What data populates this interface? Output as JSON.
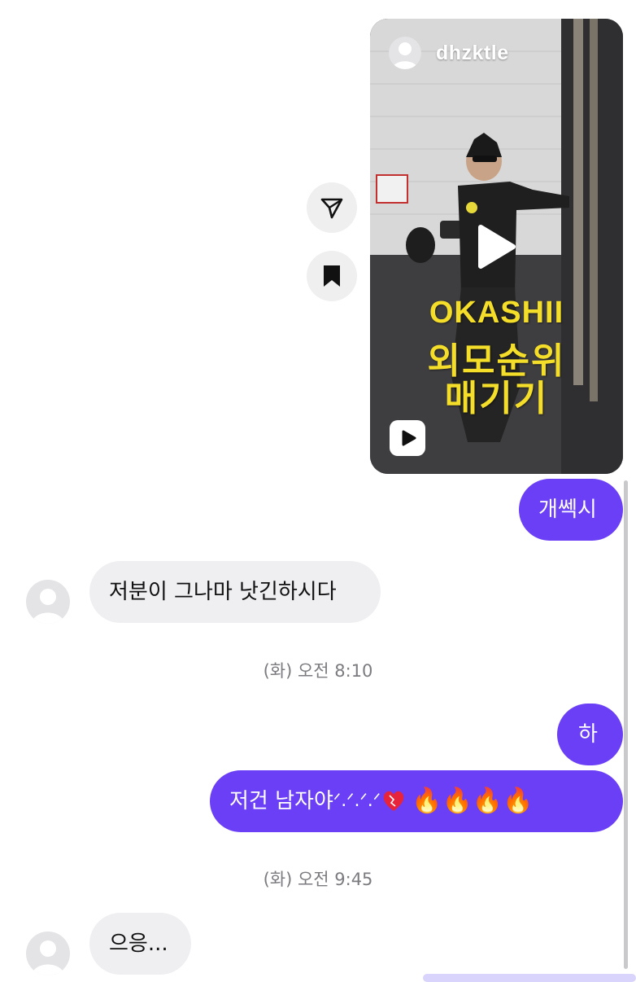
{
  "reel": {
    "username": "dhzktle",
    "overlay_line1": "OKASHII",
    "overlay_line2": "외모순위",
    "overlay_line3": "매기기",
    "icons": {
      "avatar": "user-avatar-icon",
      "play": "play-icon",
      "reels_badge": "reels-icon"
    }
  },
  "actions": {
    "share_icon": "send-icon",
    "save_icon": "bookmark-icon"
  },
  "messages": [
    {
      "sender": "me",
      "text": "개쎅시"
    },
    {
      "sender": "them",
      "text": "저분이 그나마 낫긴하시다"
    },
    {
      "sender": "me",
      "text": "하"
    },
    {
      "sender": "me",
      "text": "저건 남자야",
      "extra": "ᐟ.ᐟ.ᐟ.ᐟ",
      "emojis": "🔥🔥🔥🔥"
    },
    {
      "sender": "them",
      "text": "으응..."
    }
  ],
  "timestamps": [
    "(화) 오전 8:10",
    "(화) 오전 9:45"
  ],
  "colors": {
    "outgoing_bubble": "#6a3ff6",
    "incoming_bubble": "#efeff2",
    "overlay_text": "#f4de2a"
  }
}
